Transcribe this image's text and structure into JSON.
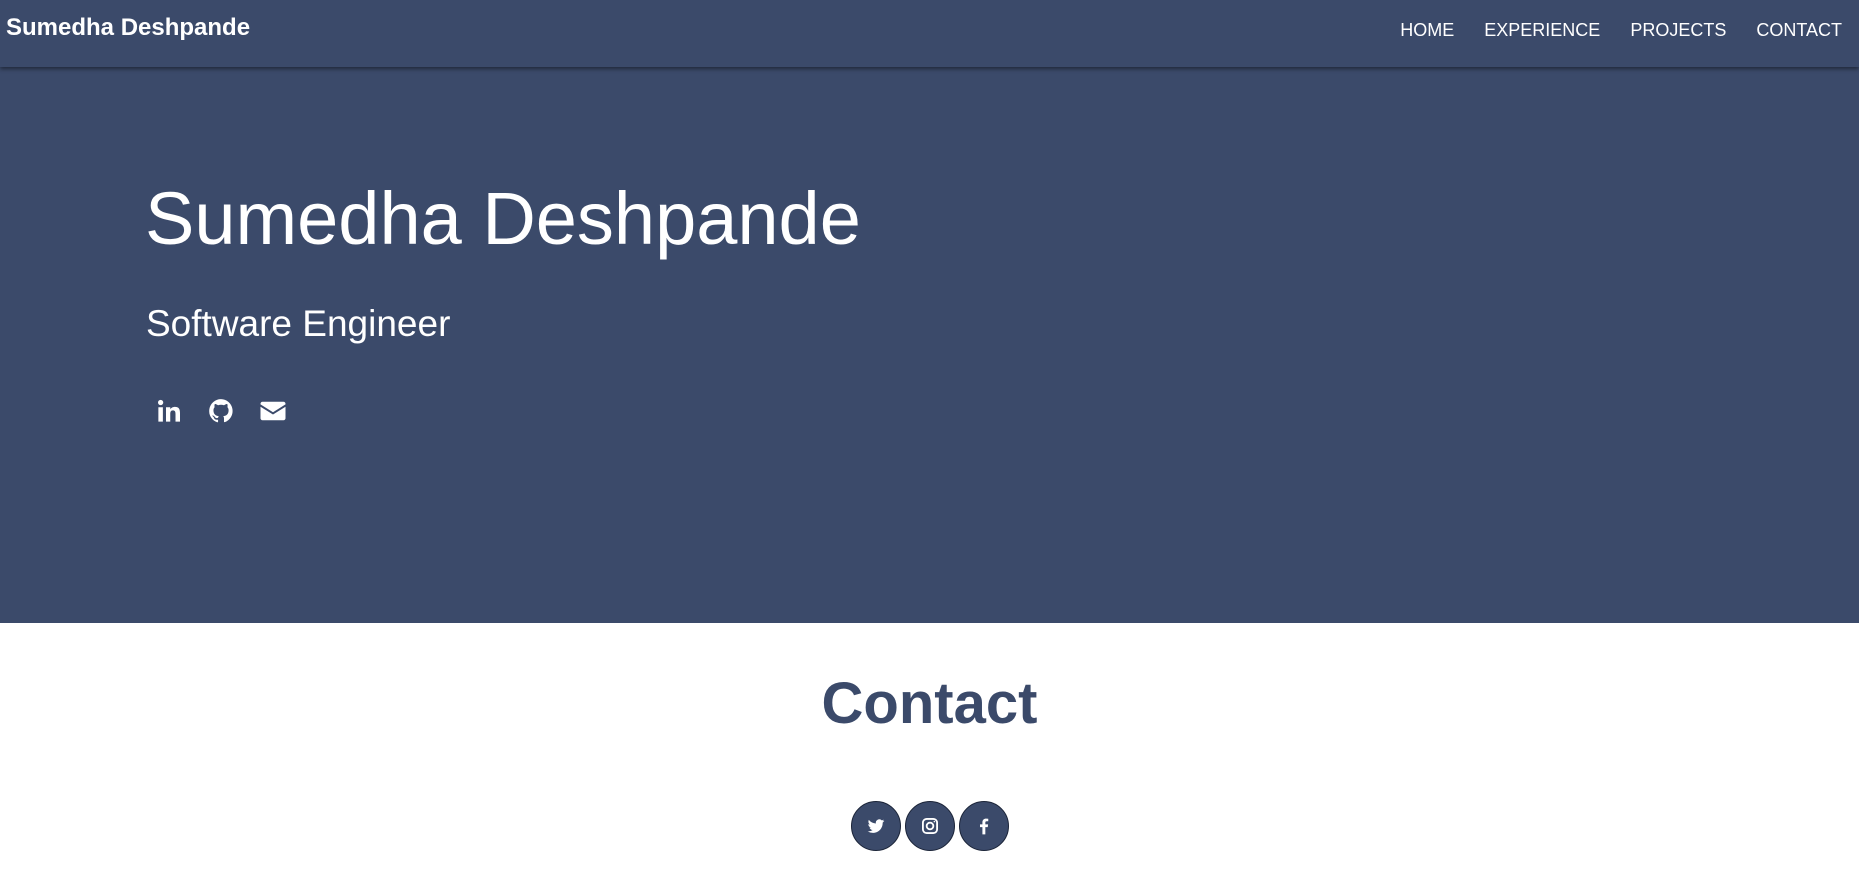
{
  "nav": {
    "brand": "Sumedha Deshpande",
    "links": [
      {
        "label": "HOME"
      },
      {
        "label": "EXPERIENCE"
      },
      {
        "label": "PROJECTS"
      },
      {
        "label": "CONTACT"
      }
    ]
  },
  "hero": {
    "name": "Sumedha Deshpande",
    "title": "Software Engineer",
    "icons": [
      "linkedin-icon",
      "github-icon",
      "envelope-icon"
    ]
  },
  "contact": {
    "heading": "Contact",
    "social_icons": [
      "twitter-icon",
      "instagram-icon",
      "facebook-icon"
    ]
  },
  "colors": {
    "primary": "#3b4a6a",
    "text_light": "#ffffff",
    "background": "#ffffff"
  }
}
